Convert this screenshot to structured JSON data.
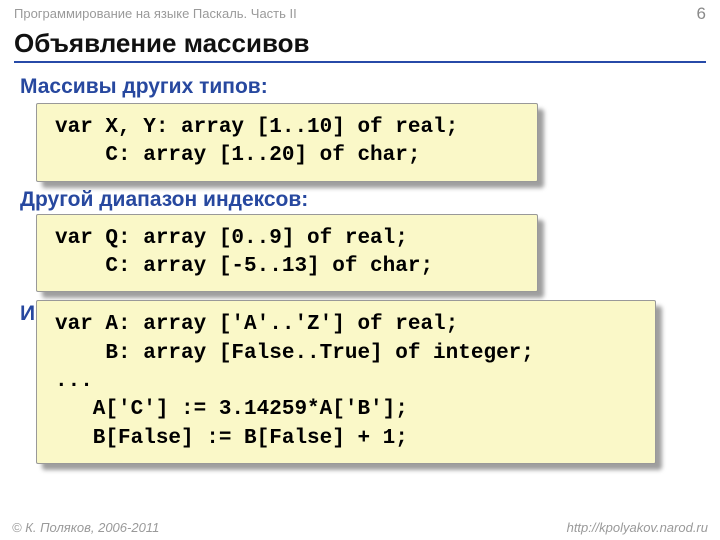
{
  "header": {
    "course": "Программирование на языке Паскаль. Часть II",
    "page": "6"
  },
  "title": "Объявление массивов",
  "sections": {
    "s1": "Массивы других типов:",
    "s2": "Другой диапазон индексов:",
    "s3": "Инд"
  },
  "code1": "var X, Y: array [1..10] of real;\n    C: array [1..20] of char;",
  "code2": "var Q: array [0..9] of real;\n    C: array [-5..13] of char;",
  "code3": "var A: array ['A'..'Z'] of real;\n    B: array [False..True] of integer;\n...\n   A['C'] := 3.14259*A['B'];\n   B[False] := B[False] + 1;",
  "footer": {
    "left": "© К. Поляков, 2006-2011",
    "right": "http://kpolyakov.narod.ru"
  }
}
